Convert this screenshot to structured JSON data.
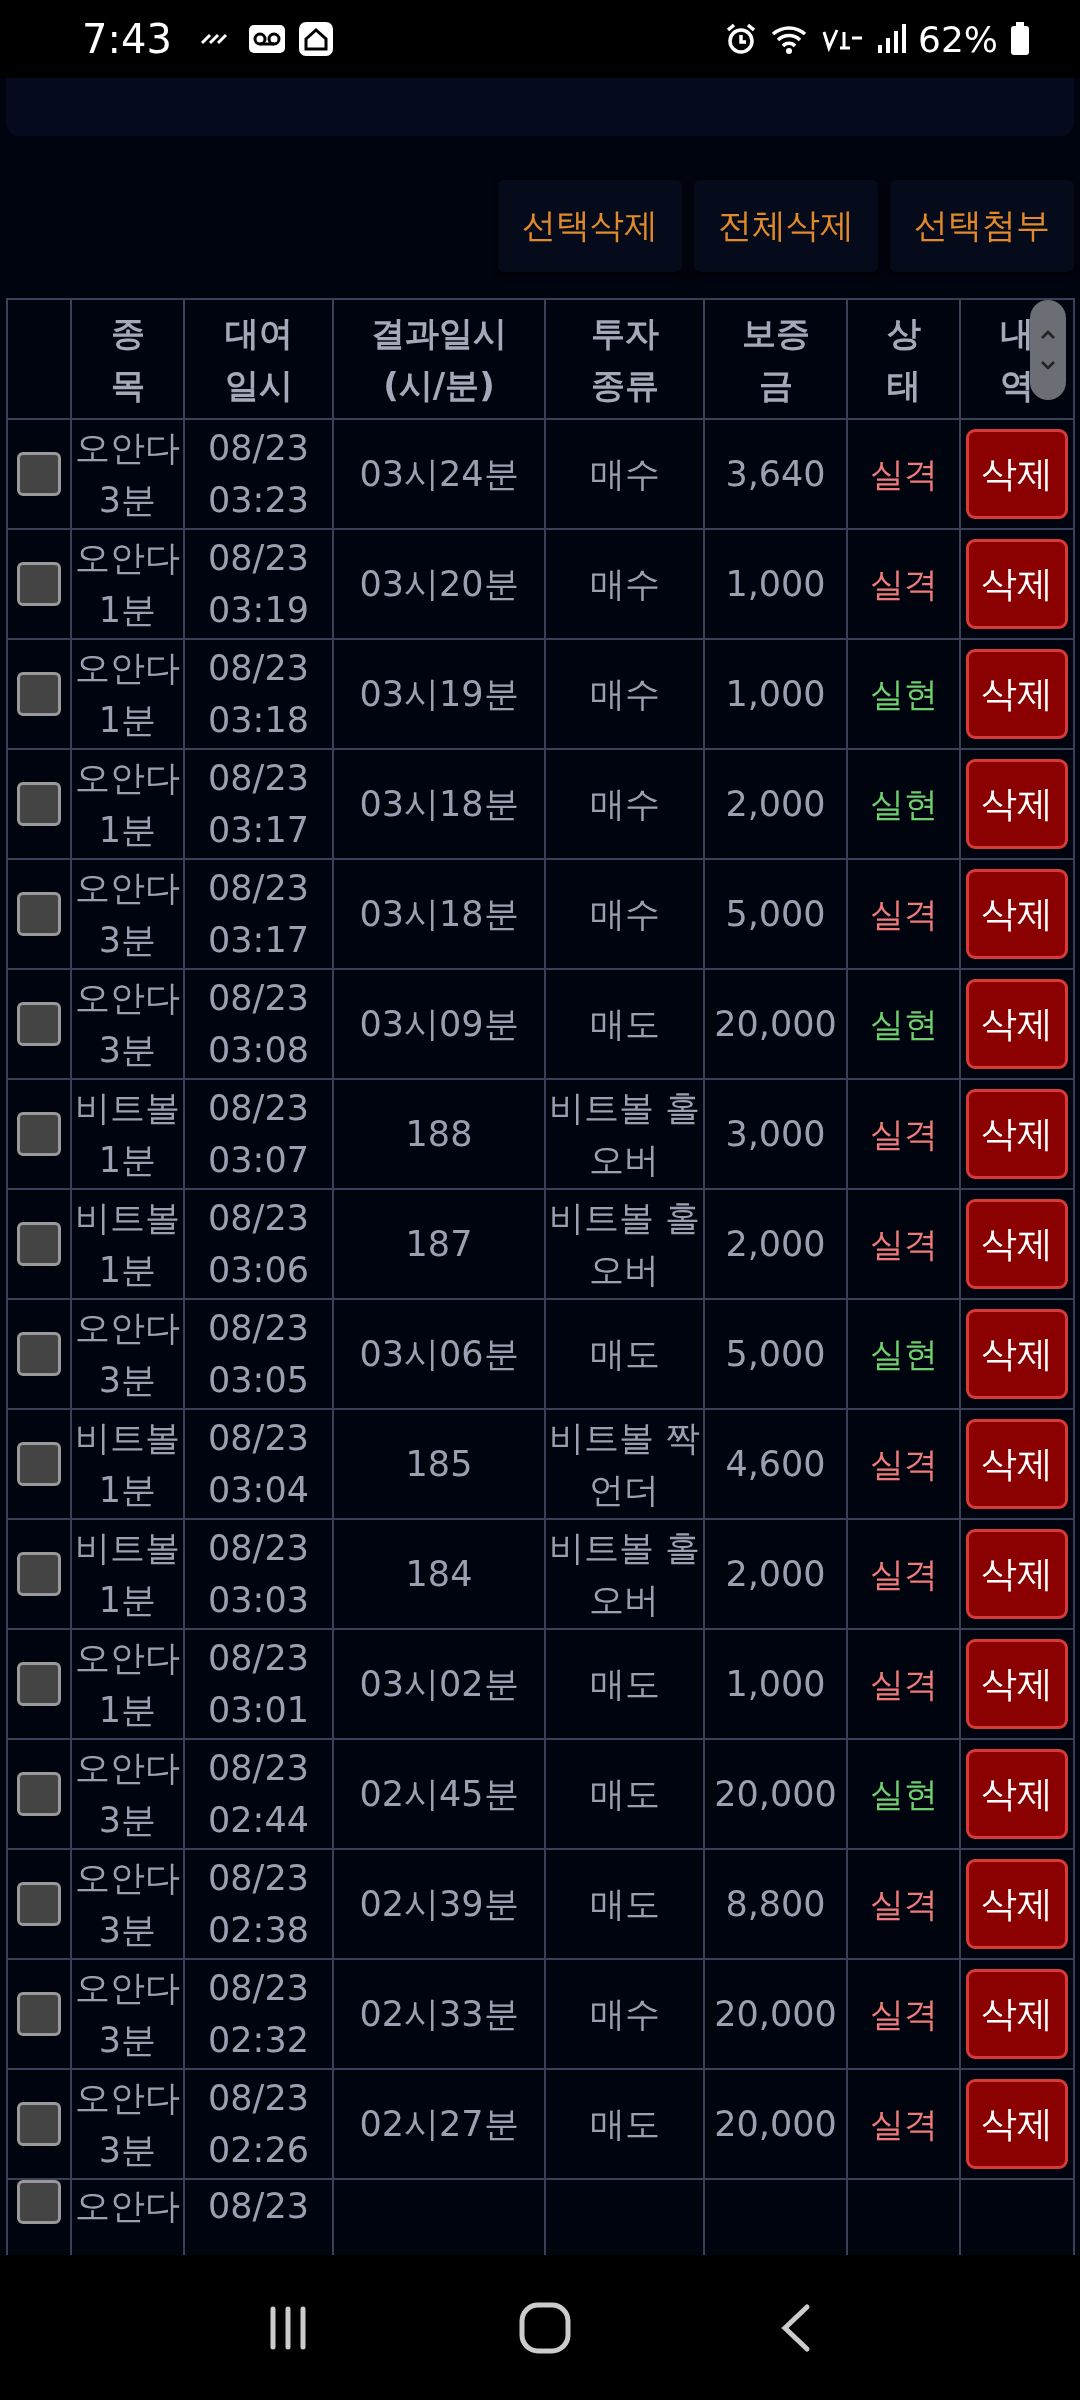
{
  "status_bar": {
    "time": "7:43",
    "battery": "62%"
  },
  "actions": [
    "선택삭제",
    "전체삭제",
    "선택첨부"
  ],
  "table": {
    "columns": [
      "",
      "종\n목",
      "대여\n일시",
      "결과일시\n(시/분)",
      "투자\n종류",
      "보증\n금",
      "상\n태",
      "내\n역"
    ],
    "rows": [
      {
        "kind": "full",
        "checked": false,
        "product": "오안다\n3분",
        "date": "08/23\n03:23",
        "result_time": "03시24분",
        "type": "매수",
        "deposit": "3,640",
        "status": "실격",
        "color": "#f07a7a",
        "action": "삭제"
      },
      {
        "kind": "full",
        "checked": false,
        "product": "오안다\n1분",
        "date": "08/23\n03:19",
        "result_time": "03시20분",
        "type": "매수",
        "deposit": "1,000",
        "status": "실격",
        "color": "#f07a7a",
        "action": "삭제"
      },
      {
        "kind": "full",
        "checked": false,
        "product": "오안다\n1분",
        "date": "08/23\n03:18",
        "result_time": "03시19분",
        "type": "매수",
        "deposit": "1,000",
        "status": "실현",
        "color": "#6fcf6f",
        "action": "삭제"
      },
      {
        "kind": "full",
        "checked": false,
        "product": "오안다\n1분",
        "date": "08/23\n03:17",
        "result_time": "03시18분",
        "type": "매수",
        "deposit": "2,000",
        "status": "실현",
        "color": "#6fcf6f",
        "action": "삭제"
      },
      {
        "kind": "full",
        "checked": false,
        "product": "오안다\n3분",
        "date": "08/23\n03:17",
        "result_time": "03시18분",
        "type": "매수",
        "deposit": "5,000",
        "status": "실격",
        "color": "#f07a7a",
        "action": "삭제"
      },
      {
        "kind": "full",
        "checked": false,
        "product": "오안다\n3분",
        "date": "08/23\n03:08",
        "result_time": "03시09분",
        "type": "매도",
        "deposit": "20,000",
        "status": "실현",
        "color": "#6fcf6f",
        "action": "삭제"
      },
      {
        "kind": "full",
        "checked": false,
        "product": "비트볼\n1분",
        "date": "08/23\n03:07",
        "result_time": "188",
        "type": "비트볼 홀\n오버",
        "deposit": "3,000",
        "status": "실격",
        "color": "#f07a7a",
        "action": "삭제"
      },
      {
        "kind": "full",
        "checked": false,
        "product": "비트볼\n1분",
        "date": "08/23\n03:06",
        "result_time": "187",
        "type": "비트볼 홀\n오버",
        "deposit": "2,000",
        "status": "실격",
        "color": "#f07a7a",
        "action": "삭제"
      },
      {
        "kind": "full",
        "checked": false,
        "product": "오안다\n3분",
        "date": "08/23\n03:05",
        "result_time": "03시06분",
        "type": "매도",
        "deposit": "5,000",
        "status": "실현",
        "color": "#6fcf6f",
        "action": "삭제"
      },
      {
        "kind": "full",
        "checked": false,
        "product": "비트볼\n1분",
        "date": "08/23\n03:04",
        "result_time": "185",
        "type": "비트볼 짝\n언더",
        "deposit": "4,600",
        "status": "실격",
        "color": "#f07a7a",
        "action": "삭제"
      },
      {
        "kind": "full",
        "checked": false,
        "product": "비트볼\n1분",
        "date": "08/23\n03:03",
        "result_time": "184",
        "type": "비트볼 홀\n오버",
        "deposit": "2,000",
        "status": "실격",
        "color": "#f07a7a",
        "action": "삭제"
      },
      {
        "kind": "full",
        "checked": false,
        "product": "오안다\n1분",
        "date": "08/23\n03:01",
        "result_time": "03시02분",
        "type": "매도",
        "deposit": "1,000",
        "status": "실격",
        "color": "#f07a7a",
        "action": "삭제"
      },
      {
        "kind": "full",
        "checked": false,
        "product": "오안다\n3분",
        "date": "08/23\n02:44",
        "result_time": "02시45분",
        "type": "매도",
        "deposit": "20,000",
        "status": "실현",
        "color": "#6fcf6f",
        "action": "삭제"
      },
      {
        "kind": "full",
        "checked": false,
        "product": "오안다\n3분",
        "date": "08/23\n02:38",
        "result_time": "02시39분",
        "type": "매도",
        "deposit": "8,800",
        "status": "실격",
        "color": "#f07a7a",
        "action": "삭제"
      },
      {
        "kind": "full",
        "checked": false,
        "product": "오안다\n3분",
        "date": "08/23\n02:32",
        "result_time": "02시33분",
        "type": "매수",
        "deposit": "20,000",
        "status": "실격",
        "color": "#f07a7a",
        "action": "삭제"
      },
      {
        "kind": "full",
        "checked": false,
        "product": "오안다\n3분",
        "date": "08/23\n02:26",
        "result_time": "02시27분",
        "type": "매도",
        "deposit": "20,000",
        "status": "실격",
        "color": "#f07a7a",
        "action": "삭제"
      },
      {
        "kind": "partial",
        "checked": false,
        "product": "오안다",
        "date": "08/23"
      }
    ]
  }
}
